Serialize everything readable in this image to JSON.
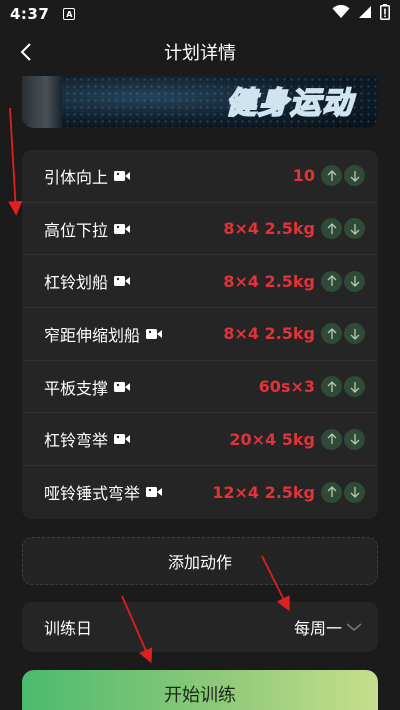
{
  "status_bar": {
    "time": "4:37",
    "notification_letter": "A"
  },
  "header": {
    "title": "计划详情"
  },
  "banner": {
    "text": "健身运动"
  },
  "exercises": [
    {
      "name": "引体向上",
      "amount": "10"
    },
    {
      "name": "高位下拉",
      "amount": "8×4 2.5kg"
    },
    {
      "name": "杠铃划船",
      "amount": "8×4 2.5kg"
    },
    {
      "name": "窄距伸缩划船",
      "amount": "8×4 2.5kg"
    },
    {
      "name": "平板支撑",
      "amount": "60s×3"
    },
    {
      "name": "杠铃弯举",
      "amount": "20×4 5kg"
    },
    {
      "name": "哑铃锤式弯举",
      "amount": "12×4 2.5kg"
    }
  ],
  "add_action": {
    "label": "添加动作"
  },
  "training_day": {
    "label": "训练日",
    "value": "每周一"
  },
  "start_button": {
    "label": "开始训练"
  },
  "colors": {
    "amount": "#e0333a",
    "arrow_button": "#2f4a36",
    "start_gradient": [
      "#4cba6d",
      "#c7df8c"
    ],
    "annotation": "#e02020"
  }
}
